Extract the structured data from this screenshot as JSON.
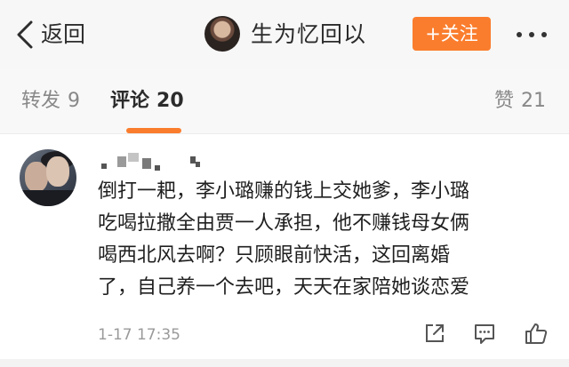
{
  "navbar": {
    "back_label": "返回",
    "title": "生为忆回以",
    "follow_label": "+关注",
    "accent_color": "#fa7d2d",
    "icons": [
      "chevron-left-icon",
      "more-dots-icon"
    ]
  },
  "tabs": {
    "repost": {
      "label": "转发",
      "count": "9"
    },
    "comment": {
      "label": "评论",
      "count": "20",
      "active": true
    },
    "like": {
      "label": "赞",
      "count": "21"
    }
  },
  "comment": {
    "lines": [
      "倒打一耙，李小璐赚的钱上交她爹，李小璐",
      "吃喝拉撒全由贾一人承担，他不赚钱母女俩",
      "喝西北风去啊？只顾眼前快活，这回离婚",
      "了，自己养一个去吧，天天在家陪她谈恋爱"
    ],
    "time": "1-17 17:35",
    "actions": [
      "share-icon",
      "reply-icon",
      "thumbs-up-icon"
    ]
  }
}
